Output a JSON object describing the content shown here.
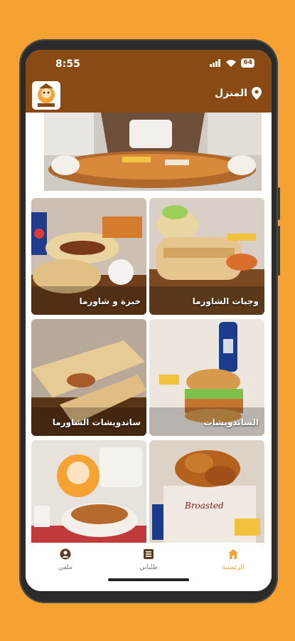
{
  "status": {
    "time": "8:55",
    "battery": "64"
  },
  "header": {
    "location_label": "المنزل",
    "logo_alt": "Sudani logo"
  },
  "banner": {
    "description": "food platter"
  },
  "categories": [
    {
      "label": "وجبات الشاورما"
    },
    {
      "label": "خبزة و شاورما"
    },
    {
      "label": "الساندويشات"
    },
    {
      "label": "ساندويشات الشاورما"
    },
    {
      "label": ""
    },
    {
      "label": ""
    }
  ],
  "nav": {
    "home": "الرئيسية",
    "orders": "طلباتي",
    "profile": "ملفي"
  },
  "colors": {
    "brand": "#8A4A14",
    "accent": "#F6A233",
    "background": "#F6A233"
  }
}
